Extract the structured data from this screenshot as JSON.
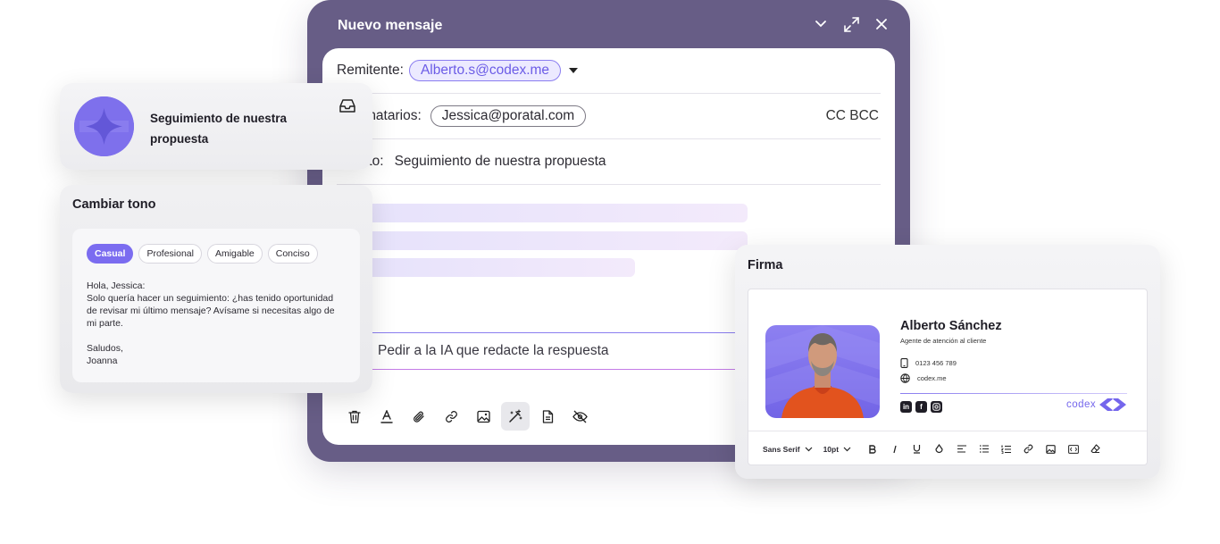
{
  "compose": {
    "title": "Nuevo mensaje",
    "sender_label": "Remitente:",
    "sender_value": "Alberto.s@codex.me",
    "recipients_label": "Destinatarios:",
    "recipients_value": "Jessica@poratal.com",
    "cc_bcc": "CC  BCC",
    "subject_label": "Asunto:",
    "subject_value": "Seguimiento de nuestra propuesta",
    "ai_prompt_placeholder": "Pedir a la IA que redacte la respuesta"
  },
  "toolbar": {
    "icons": [
      "trash-icon",
      "text-color-icon",
      "attach-icon",
      "link-icon",
      "image-icon",
      "ai-wand-icon",
      "document-icon",
      "hide-icon"
    ],
    "active": "ai-wand-icon"
  },
  "notification": {
    "title": "Seguimiento de nuestra propuesta",
    "icon": "inbox-icon",
    "logo_color": "#7e70ec"
  },
  "tone": {
    "title": "Cambiar tono",
    "tabs": [
      "Casual",
      "Profesional",
      "Amigable",
      "Conciso"
    ],
    "active_tab": "Casual",
    "greeting": "Hola, Jessica:",
    "body": "Solo quería hacer un seguimiento: ¿has tenido oportunidad de revisar mi último mensaje? Avísame si necesitas algo de mi parte.",
    "closing": "Saludos,",
    "signoff": "Joanna"
  },
  "signature": {
    "title": "Firma",
    "name": "Alberto Sánchez",
    "role": "Agente de atención al cliente",
    "phone": "0123 456 789",
    "website": "codex.me",
    "brand": "codex",
    "socials": [
      "linkedin-icon",
      "facebook-icon",
      "instagram-icon"
    ],
    "font": "Sans Serif",
    "font_size": "10pt",
    "accent": "#7466ec"
  }
}
